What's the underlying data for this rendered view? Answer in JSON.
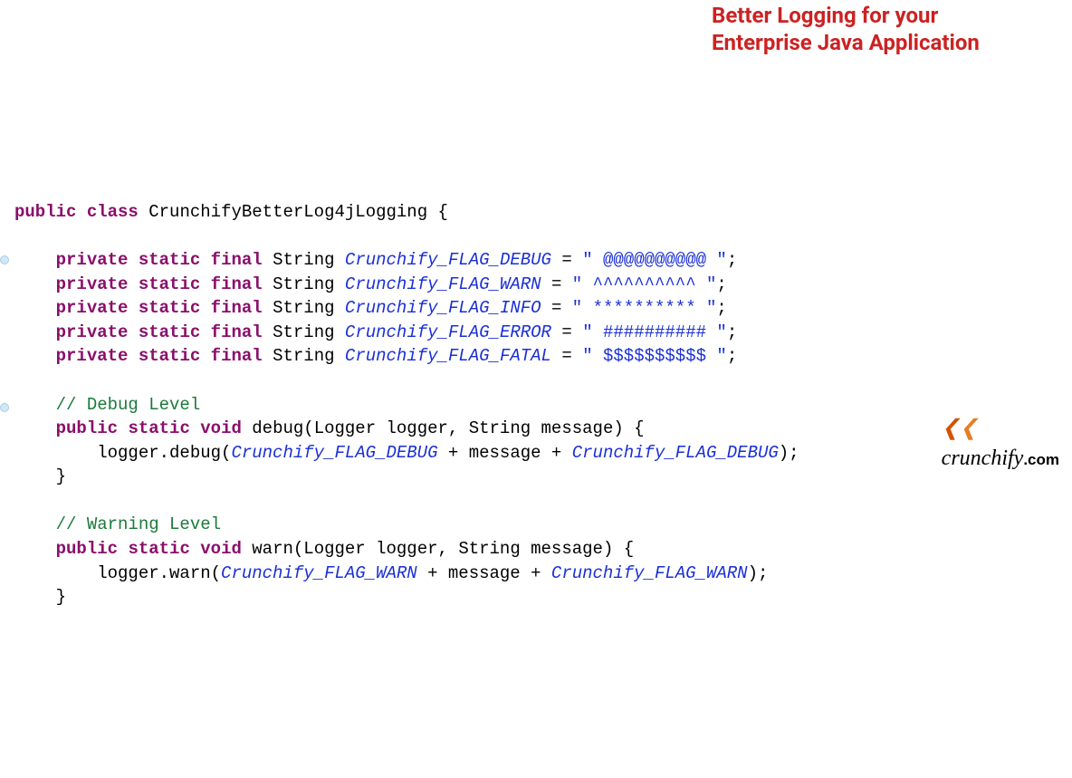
{
  "headline": {
    "line1": "Better Logging for your",
    "line2": "Enterprise Java Application"
  },
  "code": {
    "kw_public": "public",
    "kw_class": "class",
    "class_name": "CrunchifyBetterLog4jLogging",
    "brace_open": "{",
    "brace_close": "}",
    "kw_private": "private",
    "kw_static": "static",
    "kw_final": "final",
    "kw_void": "void",
    "type_String": "String",
    "field_debug": "Crunchify_FLAG_DEBUG",
    "field_warn": "Crunchify_FLAG_WARN",
    "field_info": "Crunchify_FLAG_INFO",
    "field_error": "Crunchify_FLAG_ERROR",
    "field_fatal": "Crunchify_FLAG_FATAL",
    "val_debug": "\" @@@@@@@@@@ \"",
    "val_warn": "\" ^^^^^^^^^^ \"",
    "val_info": "\" ********** \"",
    "val_error": "\" ########## \"",
    "val_fatal": "\" $$$$$$$$$$ \"",
    "eq": " = ",
    "semi": ";",
    "cmt_debug": "// Debug Level",
    "cmt_warn": "// Warning Level",
    "sig_debug": "debug(Logger logger, String message) {",
    "sig_warn": "warn(Logger logger, String message) {",
    "body_pre_d": "        logger.debug(",
    "body_pre_w": "        logger.warn(",
    "plus_msg": " + message + ",
    "paren_semi": ");"
  },
  "watermark": {
    "name": "crunchify",
    "suffix": ".com"
  }
}
